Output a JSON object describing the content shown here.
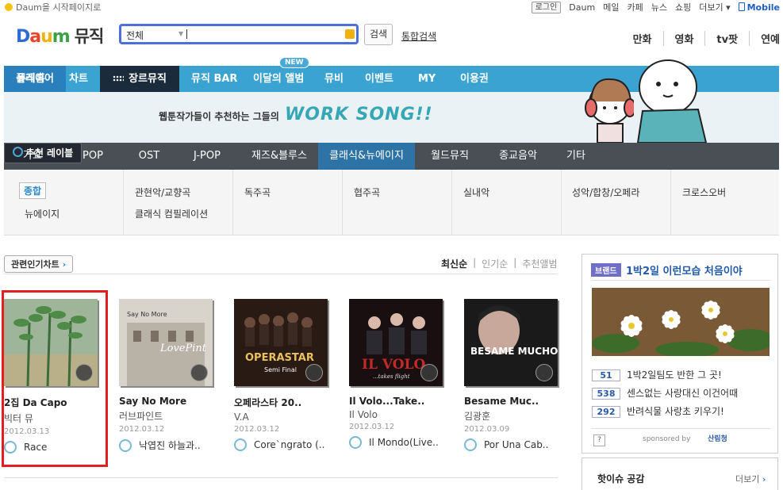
{
  "topbar": {
    "home_label": "Daum을 시작페이지로",
    "utils": [
      "로그인",
      "Daum",
      "메일",
      "카페",
      "뉴스",
      "쇼핑",
      "더보기"
    ],
    "mobile_label": "Mobile"
  },
  "header": {
    "logo_text": "Daum",
    "service_name": "뮤직",
    "search_category": "전체",
    "search_button": "검색",
    "integrated_search": "통합검색",
    "services": [
      "만화",
      "영화",
      "tv팟",
      "연예"
    ]
  },
  "main_nav": {
    "items": [
      "뮤직홈",
      "차트",
      "장르뮤직",
      "뮤직 BAR",
      "이달의 앨범",
      "뮤비",
      "이벤트",
      "MY",
      "이용권"
    ],
    "new_badge": "NEW",
    "player_label": "플레이어",
    "active_index": 2
  },
  "banner": {
    "text": "웹툰작가들이 추천하는 그들의",
    "highlight": "WORK SONG!!"
  },
  "genre_nav": {
    "items": [
      "가요",
      "POP",
      "OST",
      "J-POP",
      "재즈&블루스",
      "클래식&뉴에이지",
      "월드뮤직",
      "종교음악",
      "기타"
    ],
    "active_index": 5,
    "recommend_label": "추천 레이블"
  },
  "subgenres": {
    "col1": [
      "종합",
      "뉴에이지"
    ],
    "col2": [
      "관현악/교향곡",
      "클래식 컴필레이션"
    ],
    "col3": [
      "독주곡"
    ],
    "col4": [
      "협주곡"
    ],
    "col5": [
      "실내악"
    ],
    "col6": [
      "성악/합창/오페라"
    ],
    "col7": [
      "크로스오버"
    ]
  },
  "content": {
    "chart_button": "관련인기차트",
    "sorts": [
      "최신순",
      "인기순",
      "추천앨범"
    ],
    "albums": [
      {
        "title": "2집 Da Capo",
        "artist": "빅터 뮤",
        "date": "2012.03.13",
        "track": "Race"
      },
      {
        "title": "Say No More",
        "artist": "러브파인트",
        "date": "2012.03.12",
        "track": "낙엽진 하늘과.."
      },
      {
        "title": "오페라스타 20..",
        "artist": "V.A",
        "date": "2012.03.12",
        "track": "Core`ngrato (.."
      },
      {
        "title": "Il Volo...Take..",
        "artist": "Il Volo",
        "date": "2012.03.12",
        "track": "Il Mondo(Live.."
      },
      {
        "title": "Besame Muc..",
        "artist": "김광훈",
        "date": "2012.03.09",
        "track": "Por Una Cab.."
      }
    ],
    "cover_texts": [
      "",
      "Say No More",
      "OPERASTAR",
      "IL VOLO",
      "BESAME MUCHO"
    ],
    "cover_texts2": [
      "",
      "LovePint",
      "Semi Final",
      "...takes flight",
      ""
    ]
  },
  "brand": {
    "tag": "브랜드",
    "title": "1박2일 이런모습 처음이야",
    "items": [
      {
        "num": "51",
        "text": "1박2일팀도 반한 그 곳!"
      },
      {
        "num": "538",
        "text": "센스없는 사랑대신 이건어때"
      },
      {
        "num": "292",
        "text": "반려식물 사랑초 키우기!"
      }
    ],
    "help": "?",
    "sponsored": "sponsored by",
    "sponsor_name": "산림청"
  },
  "hot_issue": {
    "title": "핫이슈 공감",
    "more": "더보기"
  }
}
